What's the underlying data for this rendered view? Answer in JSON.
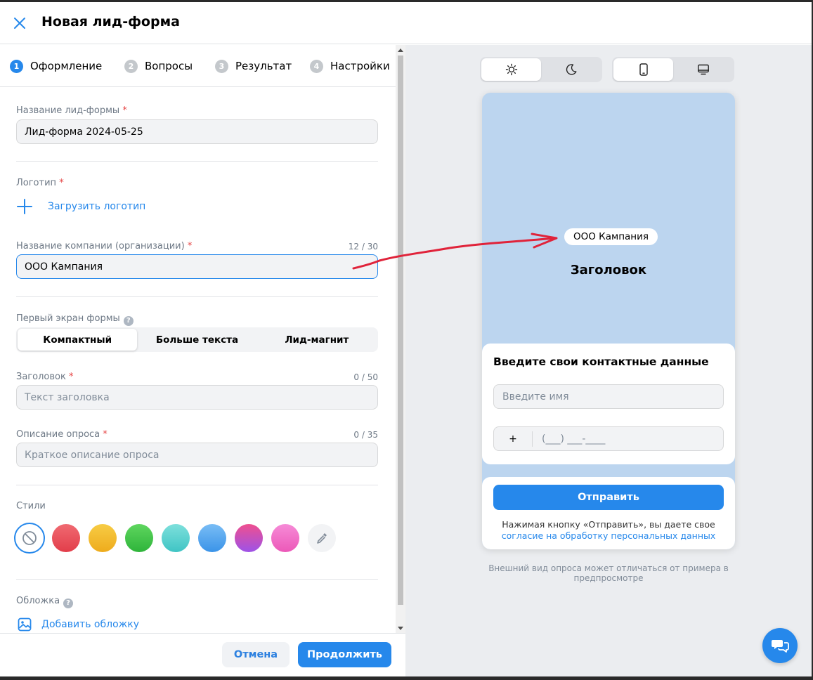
{
  "header": {
    "title": "Новая лид-форма"
  },
  "steps": [
    {
      "num": "1",
      "label": "Оформление"
    },
    {
      "num": "2",
      "label": "Вопросы"
    },
    {
      "num": "3",
      "label": "Результат"
    },
    {
      "num": "4",
      "label": "Настройки"
    }
  ],
  "form": {
    "form_name": {
      "label": "Название лид-формы",
      "value": "Лид-форма 2024-05-25"
    },
    "logo": {
      "label": "Логотип",
      "upload_label": "Загрузить логотип"
    },
    "company": {
      "label": "Название компании (организации)",
      "counter": "12 / 30",
      "value": "ООО Кампания"
    },
    "first_screen": {
      "label": "Первый экран формы",
      "options": [
        "Компактный",
        "Больше текста",
        "Лид-магнит"
      ],
      "selected": "Компактный"
    },
    "heading": {
      "label": "Заголовок",
      "counter": "0 / 50",
      "placeholder": "Текст заголовка"
    },
    "description": {
      "label": "Описание опроса",
      "counter": "0 / 35",
      "placeholder": "Краткое описание опроса"
    },
    "styles": {
      "label": "Стили",
      "swatches": [
        "none",
        "#e8505b",
        "#f2b92b",
        "#3fbf4a",
        "#5dd3d0",
        "#4fa3ee",
        "#c84fc4",
        "#ef6fcf",
        "picker"
      ]
    },
    "cover": {
      "label": "Обложка",
      "add_label": "Добавить обложку"
    },
    "required_mark": "*",
    "help_mark": "?"
  },
  "footer": {
    "cancel_label": "Отмена",
    "continue_label": "Продолжить"
  },
  "preview": {
    "company_chip": "ООО Кампания",
    "title": "Заголовок",
    "card_title": "Введите свои контактные данные",
    "name_placeholder": "Введите имя",
    "phone_prefix": "+",
    "phone_mask": "(___) ___-____",
    "send_label": "Отправить",
    "consent_text": "Нажимая кнопку «Отправить», вы даете свое",
    "consent_link": "согласие на обработку персональных данных",
    "note": "Внешний вид опроса может отличаться от примера в предпросмотре"
  },
  "colors": {
    "accent": "#2688eb",
    "preview_bg": "#bcd5ef",
    "annotation": "#e0233a"
  },
  "icons": [
    "close-icon",
    "sun-icon",
    "moon-icon",
    "mobile-icon",
    "desktop-icon",
    "plus-icon",
    "help-icon",
    "no-style-icon",
    "eyedropper-icon",
    "image-icon",
    "chat-icon"
  ]
}
